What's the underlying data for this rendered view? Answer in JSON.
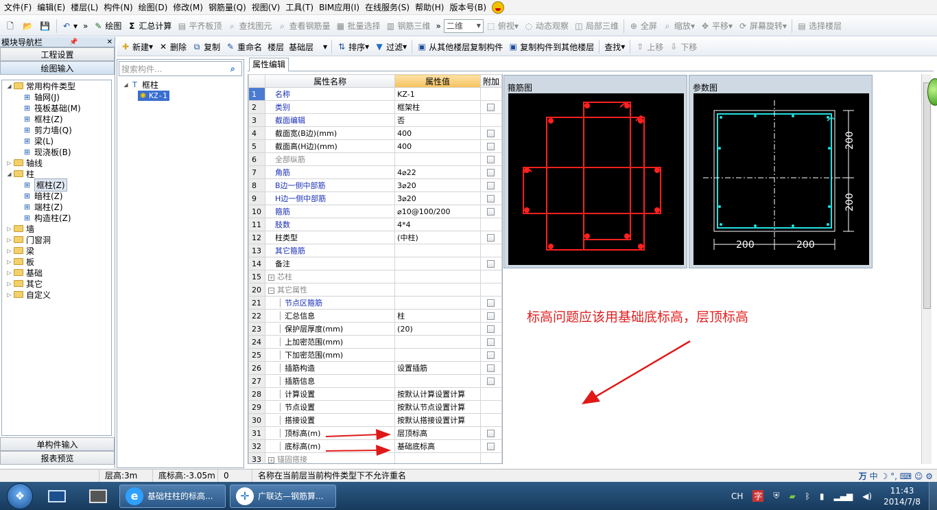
{
  "menubar": {
    "items": [
      "文件(F)",
      "编辑(E)",
      "楼层(L)",
      "构件(N)",
      "绘图(D)",
      "修改(M)",
      "钢筋量(Q)",
      "视图(V)",
      "工具(T)",
      "BIM应用(I)",
      "在线服务(S)",
      "帮助(H)",
      "版本号(B)"
    ]
  },
  "toolbar1": {
    "draw": "绘图",
    "sum_calc": "汇总计算",
    "flush_slab": "平齐板顶",
    "find_elem": "查找图元",
    "view_rebar": "查看钢筋量",
    "batch_select": "批量选择",
    "rebar_3d": "钢筋三维",
    "view_mode": "二维",
    "top_view": "俯视",
    "dynamic_view": "动态观察",
    "partial_3d": "局部三维",
    "fullscreen": "全屏",
    "zoom": "缩放",
    "pan": "平移",
    "rotate": "屏幕旋转",
    "select_floor": "选择楼层"
  },
  "left_nav": {
    "title": "模块导航栏",
    "project_settings": "工程设置",
    "drawing_input": "绘图输入",
    "single_input": "单构件输入",
    "report_preview": "报表预览",
    "tree": [
      {
        "label": "常用构件类型",
        "level": 0,
        "type": "folder",
        "expanded": true
      },
      {
        "label": "轴网(J)",
        "level": 1,
        "type": "comp"
      },
      {
        "label": "筏板基础(M)",
        "level": 1,
        "type": "comp"
      },
      {
        "label": "框柱(Z)",
        "level": 1,
        "type": "comp"
      },
      {
        "label": "剪力墙(Q)",
        "level": 1,
        "type": "comp"
      },
      {
        "label": "梁(L)",
        "level": 1,
        "type": "comp"
      },
      {
        "label": "现浇板(B)",
        "level": 1,
        "type": "comp"
      },
      {
        "label": "轴线",
        "level": 0,
        "type": "folder",
        "expanded": false
      },
      {
        "label": "柱",
        "level": 0,
        "type": "folder",
        "expanded": true
      },
      {
        "label": "框柱(Z)",
        "level": 1,
        "type": "comp",
        "selected": true
      },
      {
        "label": "暗柱(Z)",
        "level": 1,
        "type": "comp"
      },
      {
        "label": "端柱(Z)",
        "level": 1,
        "type": "comp"
      },
      {
        "label": "构造柱(Z)",
        "level": 1,
        "type": "comp"
      },
      {
        "label": "墙",
        "level": 0,
        "type": "folder",
        "expanded": false
      },
      {
        "label": "门窗洞",
        "level": 0,
        "type": "folder",
        "expanded": false
      },
      {
        "label": "梁",
        "level": 0,
        "type": "folder",
        "expanded": false
      },
      {
        "label": "板",
        "level": 0,
        "type": "folder",
        "expanded": false
      },
      {
        "label": "基础",
        "level": 0,
        "type": "folder",
        "expanded": false
      },
      {
        "label": "其它",
        "level": 0,
        "type": "folder",
        "expanded": false
      },
      {
        "label": "自定义",
        "level": 0,
        "type": "folder",
        "expanded": false
      }
    ]
  },
  "toolbar2": {
    "new": "新建",
    "delete": "删除",
    "copy": "复制",
    "rename": "重命名",
    "floor_label": "楼层",
    "floor_value": "基础层",
    "sort": "排序",
    "filter": "过滤",
    "copy_from": "从其他楼层复制构件",
    "copy_to": "复制构件到其他楼层",
    "find": "查找",
    "move_up": "上移",
    "move_down": "下移"
  },
  "component_panel": {
    "search_placeholder": "搜索构件...",
    "root": "框柱",
    "child": "KZ-1"
  },
  "props": {
    "tab": "属性编辑",
    "headers": {
      "name": "属性名称",
      "value": "属性值",
      "add": "附加"
    },
    "rows": [
      {
        "num": "1",
        "name": "名称",
        "value": "KZ-1",
        "style": "blue",
        "cb": false
      },
      {
        "num": "2",
        "name": "类别",
        "value": "框架柱",
        "style": "blue",
        "cb": true
      },
      {
        "num": "3",
        "name": "截面编辑",
        "value": "否",
        "style": "blue",
        "cb": false
      },
      {
        "num": "4",
        "name": "截面宽(B边)(mm)",
        "value": "400",
        "style": "",
        "cb": true
      },
      {
        "num": "5",
        "name": "截面高(H边)(mm)",
        "value": "400",
        "style": "",
        "cb": true
      },
      {
        "num": "6",
        "name": "全部纵筋",
        "value": "",
        "style": "gray",
        "cb": true
      },
      {
        "num": "7",
        "name": "角筋",
        "value": "4⌀22",
        "style": "blue",
        "cb": true
      },
      {
        "num": "8",
        "name": "B边一侧中部筋",
        "value": "3⌀20",
        "style": "blue",
        "cb": true
      },
      {
        "num": "9",
        "name": "H边一侧中部筋",
        "value": "3⌀20",
        "style": "blue",
        "cb": true
      },
      {
        "num": "10",
        "name": "箍筋",
        "value": "⌀10@100/200",
        "style": "blue",
        "cb": true
      },
      {
        "num": "11",
        "name": "肢数",
        "value": "4*4",
        "style": "blue",
        "cb": false
      },
      {
        "num": "12",
        "name": "柱类型",
        "value": "(中柱)",
        "style": "",
        "cb": true
      },
      {
        "num": "13",
        "name": "其它箍筋",
        "value": "",
        "style": "blue",
        "cb": false
      },
      {
        "num": "14",
        "name": "备注",
        "value": "",
        "style": "",
        "cb": true
      },
      {
        "num": "15",
        "name": "芯柱",
        "value": "",
        "style": "gray",
        "cb": false,
        "box": "+"
      },
      {
        "num": "20",
        "name": "其它属性",
        "value": "",
        "style": "gray",
        "cb": false,
        "box": "−"
      },
      {
        "num": "21",
        "name": "节点区箍筋",
        "value": "",
        "style": "blue",
        "cb": true,
        "indent": true
      },
      {
        "num": "22",
        "name": "汇总信息",
        "value": "柱",
        "style": "",
        "cb": true,
        "indent": true
      },
      {
        "num": "23",
        "name": "保护层厚度(mm)",
        "value": "(20)",
        "style": "",
        "cb": true,
        "indent": true
      },
      {
        "num": "24",
        "name": "上加密范围(mm)",
        "value": "",
        "style": "",
        "cb": true,
        "indent": true
      },
      {
        "num": "25",
        "name": "下加密范围(mm)",
        "value": "",
        "style": "",
        "cb": true,
        "indent": true
      },
      {
        "num": "26",
        "name": "插筋构造",
        "value": "设置插筋",
        "style": "",
        "cb": true,
        "indent": true
      },
      {
        "num": "27",
        "name": "插筋信息",
        "value": "",
        "style": "",
        "cb": true,
        "indent": true
      },
      {
        "num": "28",
        "name": "计算设置",
        "value": "按默认计算设置计算",
        "style": "",
        "cb": false,
        "indent": true
      },
      {
        "num": "29",
        "name": "节点设置",
        "value": "按默认节点设置计算",
        "style": "",
        "cb": false,
        "indent": true
      },
      {
        "num": "30",
        "name": "搭接设置",
        "value": "按默认搭接设置计算",
        "style": "",
        "cb": false,
        "indent": true
      },
      {
        "num": "31",
        "name": "顶标高(m)",
        "value": "层顶标高",
        "style": "",
        "cb": true,
        "indent": true,
        "arrow": true
      },
      {
        "num": "32",
        "name": "底标高(m)",
        "value": "基础底标高",
        "style": "",
        "cb": true,
        "indent": true,
        "arrow": true
      },
      {
        "num": "33",
        "name": "锚固搭接",
        "value": "",
        "style": "gray",
        "cb": false,
        "box": "+"
      }
    ]
  },
  "stirrup_panel": {
    "title": "箍筋图"
  },
  "param_panel": {
    "title": "参数图",
    "dims": [
      "200",
      "200",
      "200",
      "200"
    ]
  },
  "annotation": {
    "text": "标高问题应该用基础底标高，层顶标高",
    "color": "#e02020"
  },
  "statusbar": {
    "floor_height": "层高:3m",
    "base_elev": "底标高:-3.05m",
    "zero": "0",
    "message": "名称在当前层当前构件类型下不允许重名"
  },
  "taskbar": {
    "task1": "基础柱柱的标高...",
    "task2": "广联达—钢筋算...",
    "lang": "CH",
    "time": "11:43",
    "date": "2014/7/8"
  }
}
